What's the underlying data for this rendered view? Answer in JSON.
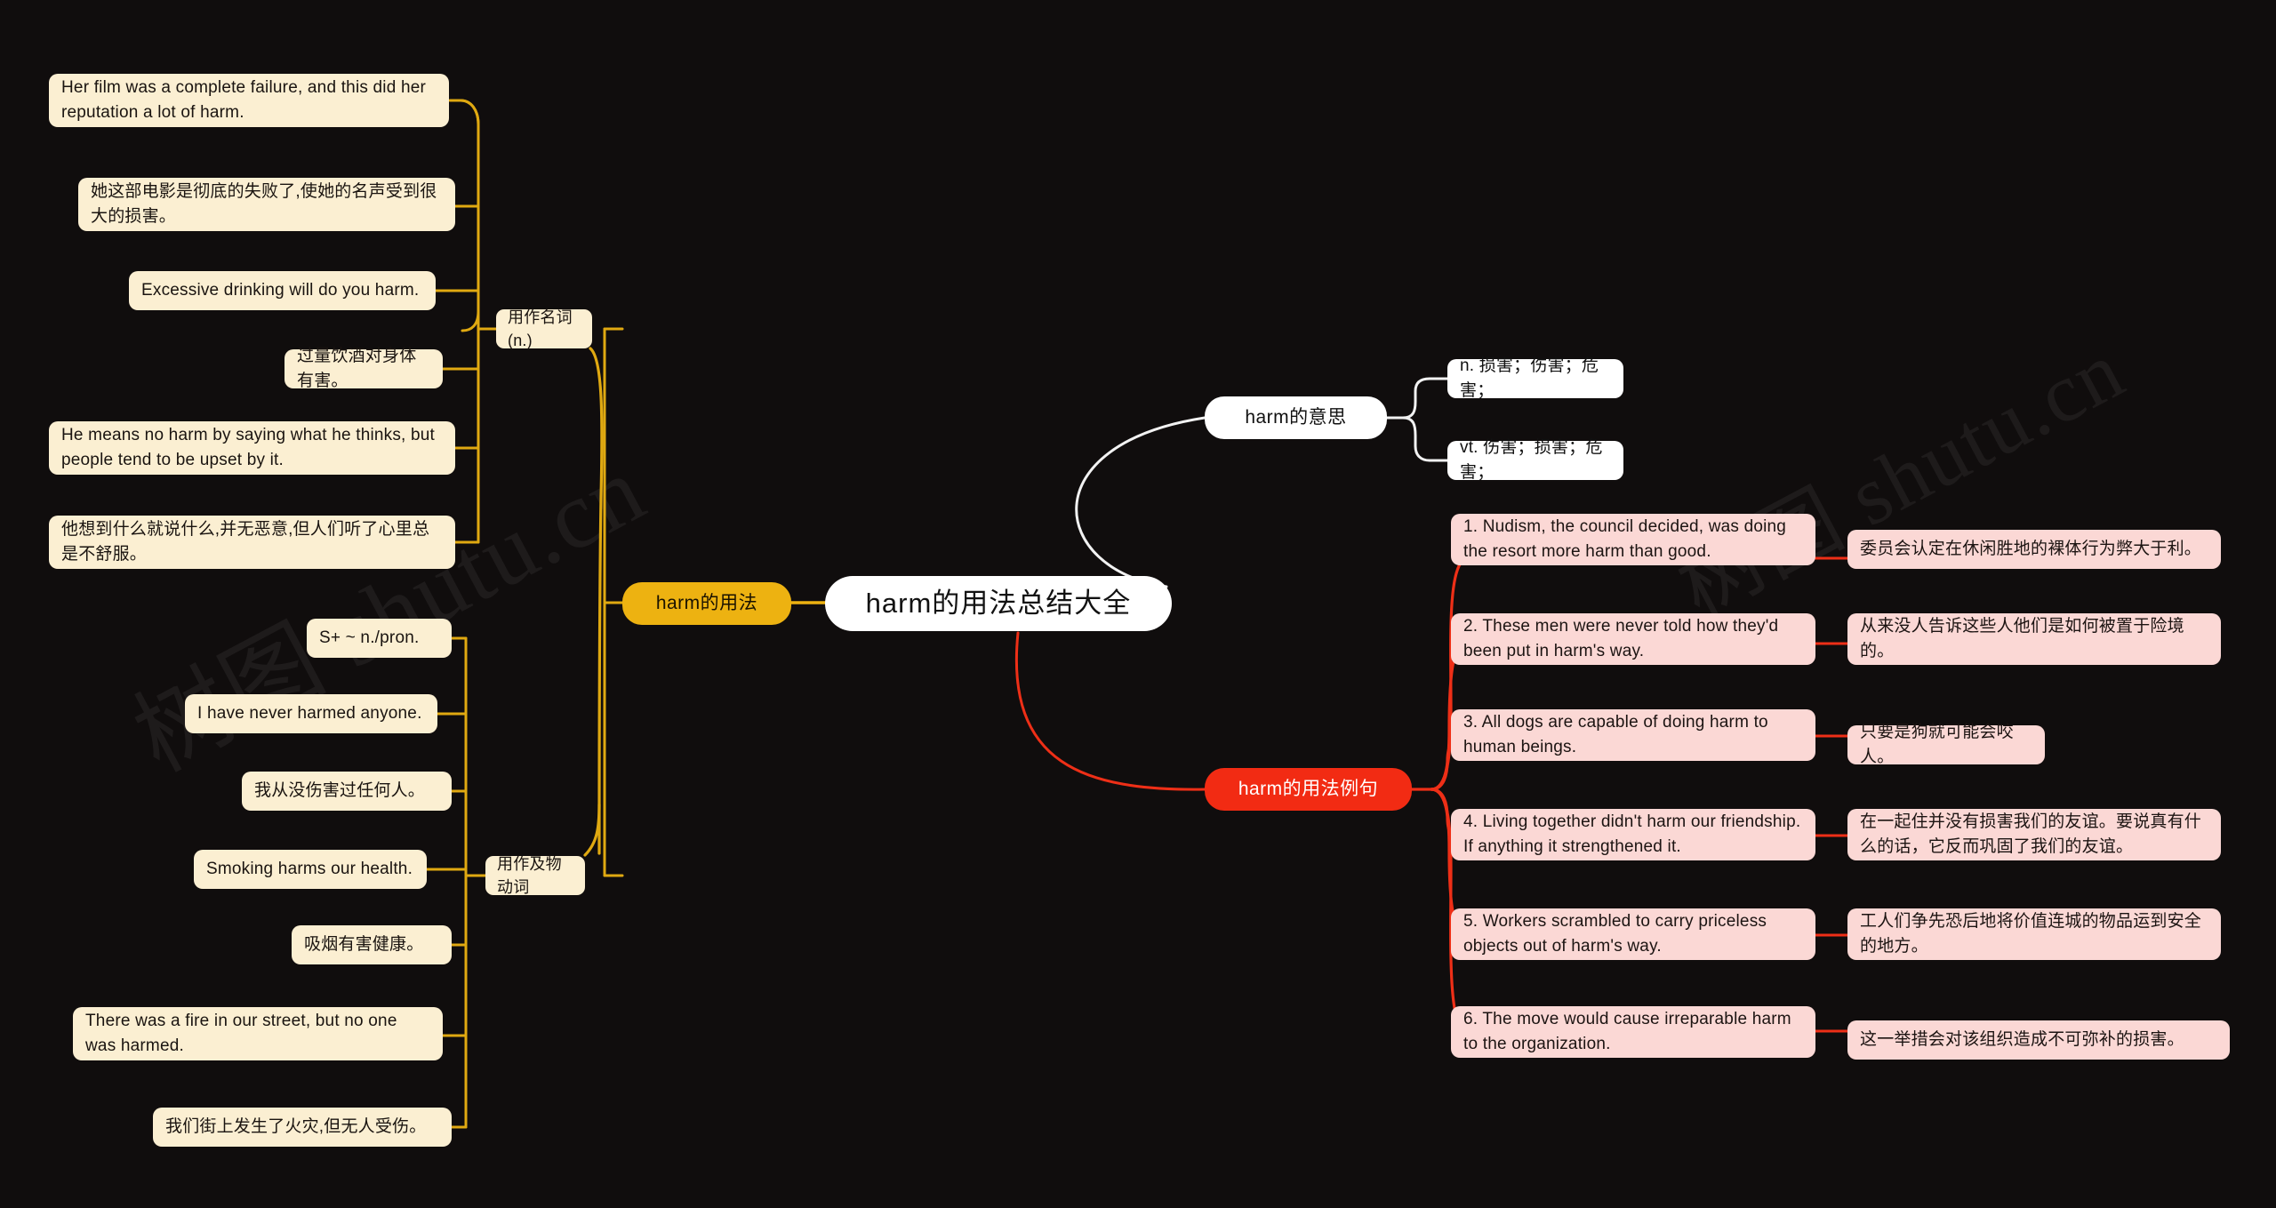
{
  "root": {
    "label": "harm的用法总结大全"
  },
  "watermarks": [
    {
      "text": "树图 shutu.cn"
    },
    {
      "text": "树图 shutu.cn"
    }
  ],
  "branches": {
    "usage": {
      "label": "harm的用法",
      "color": "#edb211",
      "sub_branches": [
        {
          "label": "用作名词(n.)",
          "items": [
            {
              "text": "Her film was a complete failure, and this did her reputation a lot of harm."
            },
            {
              "text": "她这部电影是彻底的失败了,使她的名声受到很大的损害。"
            },
            {
              "text": "Excessive drinking will do you harm."
            },
            {
              "text": "过量饮酒对身体有害。"
            },
            {
              "text": "He means no harm by saying what he thinks, but people tend to be upset by it."
            },
            {
              "text": "他想到什么就说什么,并无恶意,但人们听了心里总是不舒服。"
            }
          ]
        },
        {
          "label": "用作及物动词",
          "items": [
            {
              "text": "S+ ~ n./pron."
            },
            {
              "text": "I have never harmed anyone."
            },
            {
              "text": "我从没伤害过任何人。"
            },
            {
              "text": "Smoking harms our health."
            },
            {
              "text": "吸烟有害健康。"
            },
            {
              "text": "There was a fire in our street, but no one was harmed."
            },
            {
              "text": "我们街上发生了火灾,但无人受伤。"
            }
          ]
        }
      ]
    },
    "meaning": {
      "label": "harm的意思",
      "color": "#ffffff",
      "items": [
        {
          "text": "n. 损害；伤害；危害；"
        },
        {
          "text": "vt. 伤害；损害；危害；"
        }
      ]
    },
    "examples": {
      "label": "harm的用法例句",
      "color": "#f22b13",
      "items": [
        {
          "en": "1. Nudism, the council decided, was doing the resort more harm than good.",
          "zh": "委员会认定在休闲胜地的裸体行为弊大于利。"
        },
        {
          "en": "2. These men were never told how they'd been put in harm's way.",
          "zh": "从来没人告诉这些人他们是如何被置于险境的。"
        },
        {
          "en": "3. All dogs are capable of doing harm to human beings.",
          "zh": "只要是狗就可能会咬人。"
        },
        {
          "en": "4. Living together didn't harm our friendship. If anything it strengthened it.",
          "zh": "在一起住并没有损害我们的友谊。要说真有什么的话，它反而巩固了我们的友谊。"
        },
        {
          "en": "5. Workers scrambled to carry priceless objects out of harm's way.",
          "zh": "工人们争先恐后地将价值连城的物品运到安全的地方。"
        },
        {
          "en": "6. The move would cause irreparable harm to the organization.",
          "zh": "这一举措会对该组织造成不可弥补的损害。"
        }
      ]
    }
  }
}
